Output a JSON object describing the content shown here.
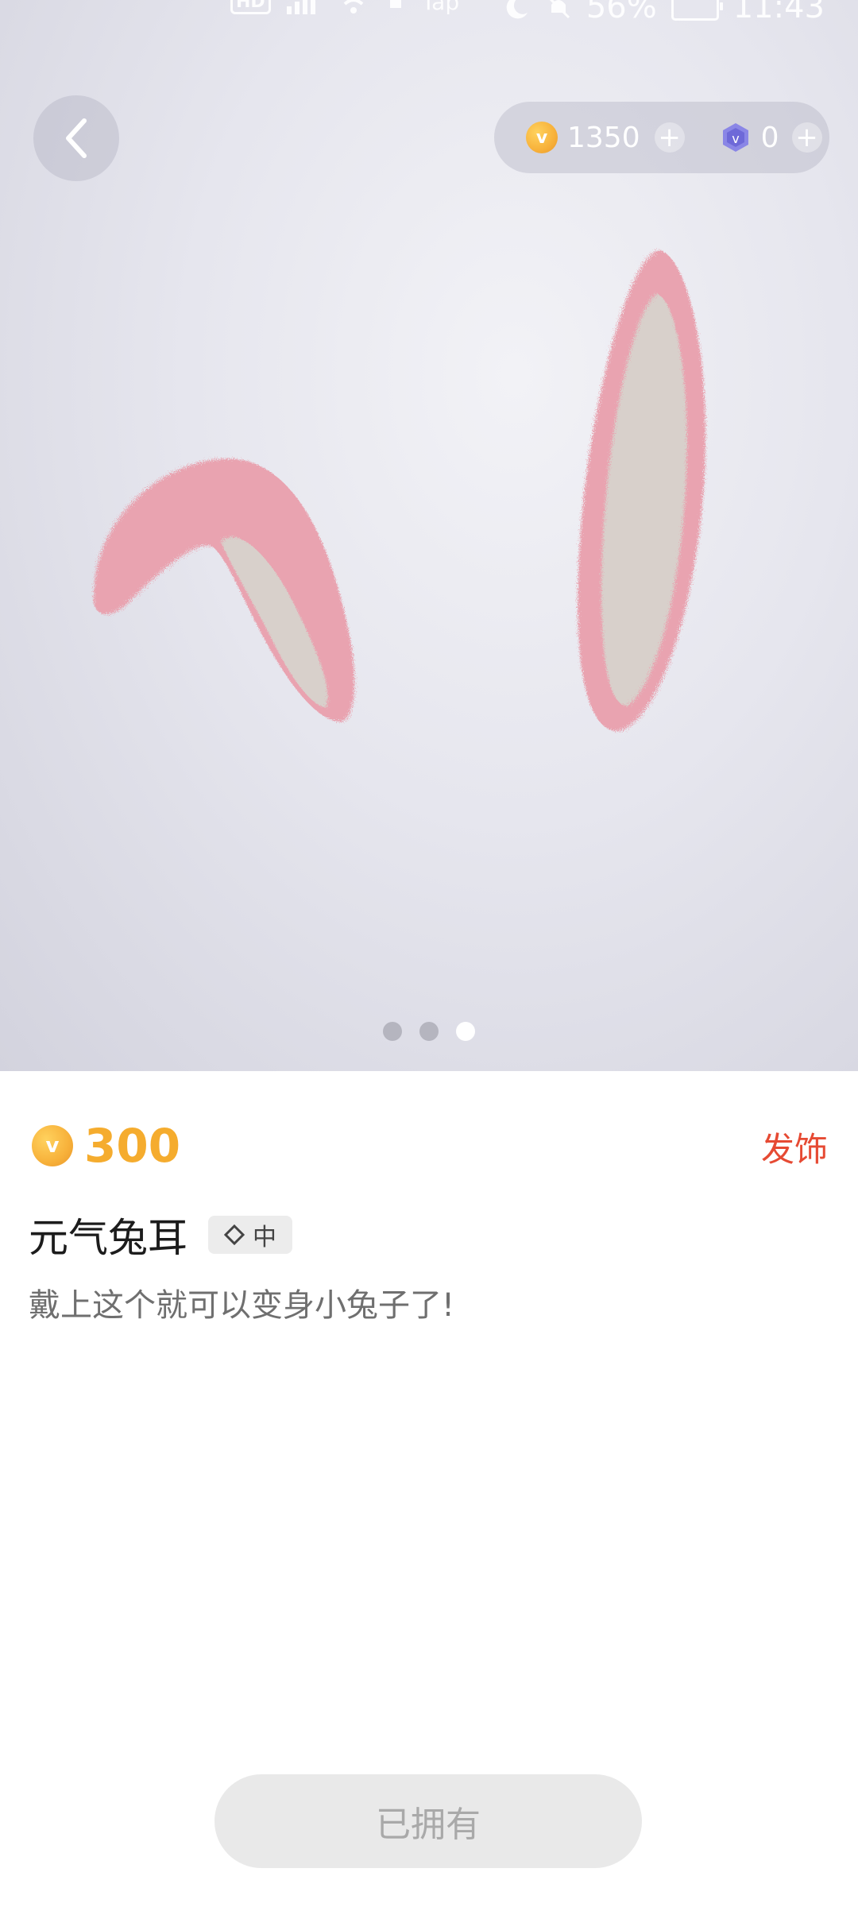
{
  "status_bar": {
    "network_badge": "HD",
    "carrier_text": "Tap",
    "battery": "56%",
    "time": "11:43"
  },
  "header": {
    "coins": "1350",
    "gems": "0"
  },
  "carousel": {
    "total_pages": 3,
    "active_page": 3
  },
  "item": {
    "price": "300",
    "category": "发饰",
    "name": "元气兔耳",
    "rarity": "中",
    "description": "戴上这个就可以变身小兔子了!",
    "action_label": "已拥有"
  },
  "colors": {
    "price": "#f5ac2e",
    "category": "#e64a33",
    "coin": "#f7b13a",
    "ear_outer": "#e9a3b0",
    "ear_inner": "#d8d0cb"
  },
  "icons": {
    "back": "chevron-left-icon",
    "coin": "coin-icon",
    "gem": "gem-icon",
    "add": "plus-icon",
    "rarity": "diamond-outline-icon"
  }
}
